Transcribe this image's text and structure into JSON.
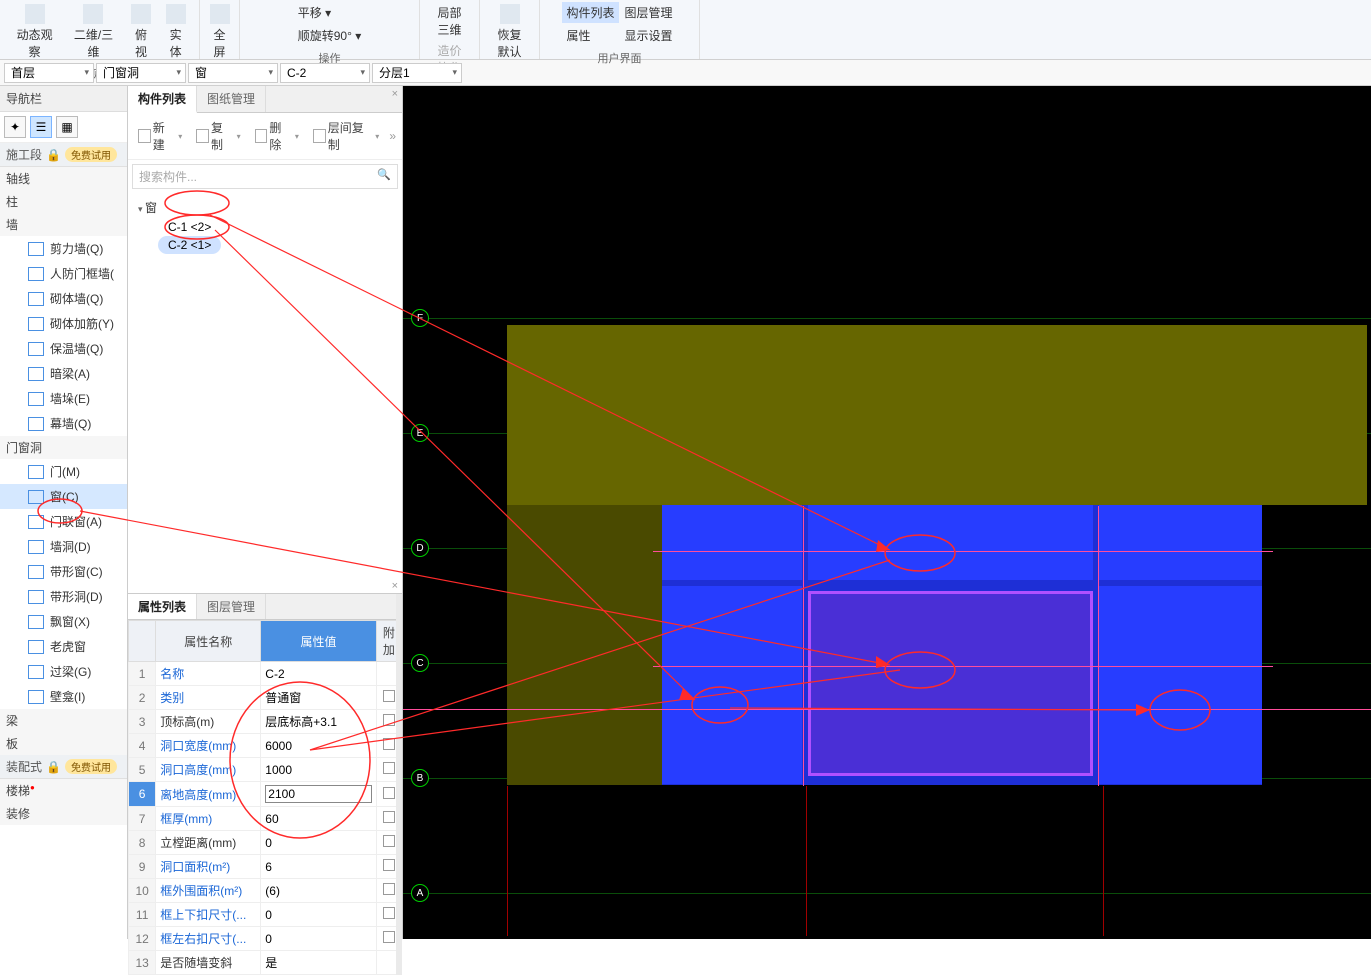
{
  "ribbon": {
    "groups": [
      {
        "label": "视图",
        "btns": [
          "动态观察",
          "二维/三维",
          "俯视",
          "实体"
        ]
      },
      {
        "label": "",
        "btns": [
          "全屏"
        ]
      },
      {
        "label": "操作",
        "btns": [
          "平移 ▾",
          "顺旋转90° ▾",
          "局部三维",
          "造价协作"
        ]
      },
      {
        "label": "",
        "btns": [
          "恢复默认"
        ]
      },
      {
        "label": "用户界面",
        "btns": [
          "构件列表",
          "属性",
          "图层管理",
          "显示设置"
        ]
      }
    ]
  },
  "dropdowns": {
    "floor": "首层",
    "category": "门窗洞",
    "type": "窗",
    "member": "C-2",
    "layer": "分层1"
  },
  "nav": {
    "title": "导航栏",
    "sections": {
      "shigong": {
        "label": "施工段",
        "pill": "免费试用",
        "lock": "🔒"
      },
      "axis": "轴线",
      "column": "柱",
      "wall": "墙",
      "wall_items": [
        "剪力墙(Q)",
        "人防门框墙(",
        "砌体墙(Q)",
        "砌体加筋(Y)",
        "保温墙(Q)",
        "暗梁(A)",
        "墙垛(E)",
        "幕墙(Q)"
      ],
      "opening": "门窗洞",
      "opening_items": [
        "门(M)",
        "窗(C)",
        "门联窗(A)",
        "墙洞(D)",
        "带形窗(C)",
        "带形洞(D)",
        "飘窗(X)",
        "老虎窗",
        "过梁(G)",
        "壁龛(I)"
      ],
      "beam": "梁",
      "slab": "板",
      "prefab": {
        "label": "装配式",
        "pill": "免费试用",
        "lock": "🔒"
      },
      "stair": "楼梯",
      "deco": "装修"
    },
    "selected_opening_idx": 1
  },
  "comp_panel": {
    "tabs": [
      "构件列表",
      "图纸管理"
    ],
    "toolbar": [
      "新建",
      "复制",
      "删除",
      "层间复制"
    ],
    "search_placeholder": "搜索构件...",
    "tree_root": "窗",
    "tree_items": [
      "C-1  <2>",
      "C-2  <1>"
    ],
    "selected_tree_idx": 1
  },
  "prop_panel": {
    "tabs": [
      "属性列表",
      "图层管理"
    ],
    "headers": [
      "",
      "属性名称",
      "属性值",
      "附加"
    ],
    "rows": [
      {
        "n": "1",
        "name": "名称",
        "val": "C-2",
        "blue": true,
        "chk": false
      },
      {
        "n": "2",
        "name": "类别",
        "val": "普通窗",
        "blue": true,
        "chk": true
      },
      {
        "n": "3",
        "name": "顶标高(m)",
        "val": "层底标高+3.1",
        "blue": false,
        "chk": true
      },
      {
        "n": "4",
        "name": "洞口宽度(mm)",
        "val": "6000",
        "blue": true,
        "chk": true
      },
      {
        "n": "5",
        "name": "洞口高度(mm)",
        "val": "1000",
        "blue": true,
        "chk": true
      },
      {
        "n": "6",
        "name": "离地高度(mm)",
        "val": "2100",
        "blue": true,
        "chk": true,
        "editing": true,
        "selrow": true
      },
      {
        "n": "7",
        "name": "框厚(mm)",
        "val": "60",
        "blue": true,
        "chk": true
      },
      {
        "n": "8",
        "name": "立樘距离(mm)",
        "val": "0",
        "blue": false,
        "chk": true
      },
      {
        "n": "9",
        "name": "洞口面积(m²)",
        "val": "6",
        "blue": true,
        "chk": true
      },
      {
        "n": "10",
        "name": "框外围面积(m²)",
        "val": "(6)",
        "blue": true,
        "chk": true
      },
      {
        "n": "11",
        "name": "框上下扣尺寸(...",
        "val": "0",
        "blue": true,
        "chk": true
      },
      {
        "n": "12",
        "name": "框左右扣尺寸(...",
        "val": "0",
        "blue": true,
        "chk": true
      },
      {
        "n": "13",
        "name": "是否随墙变斜",
        "val": "是",
        "blue": false,
        "chk": false
      }
    ]
  },
  "viewport": {
    "axis_labels": [
      "F",
      "E",
      "D",
      "C",
      "B",
      "A"
    ]
  }
}
